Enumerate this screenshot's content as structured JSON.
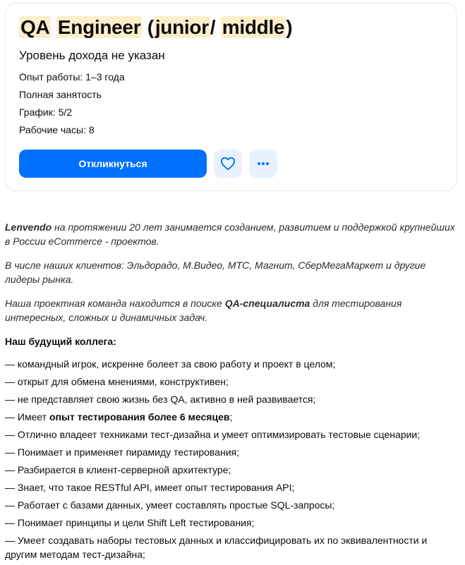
{
  "vacancy": {
    "title_parts": [
      "QA",
      "Engineer",
      "(",
      "junior",
      "/",
      "middle",
      ")"
    ],
    "salary": "Уровень дохода не указан",
    "experience": "Опыт работы: 1–3 года",
    "employment": "Полная занятость",
    "schedule": "График: 5/2",
    "hours": "Рабочие часы: 8",
    "respond_label": "Откликнуться",
    "favorite_icon": "heart-icon",
    "more_icon": "more-dots-icon",
    "accent_color": "#0070ff"
  },
  "description": {
    "p1": {
      "company": "Lenvendo",
      "text": " на протяжении 20 лет занимается созданием, развитием и поддержкой крупнейших в России eCommerce - проектов."
    },
    "p2": "В числе наших клиентов: Эльдорадо, М.Видео, МТС, Магнит, СберМегаМаркет и другие лидеры рынка.",
    "p3": {
      "before": "Наша проектная команда находится в поиске ",
      "bold": "QA-специалиста",
      "after": " для тестирования интересных, сложных и динамичных задач."
    },
    "colleague_heading": "Наш будущий коллега:",
    "items": [
      "— командный игрок, искренне болеет за свою работу и проект в целом;",
      "— открыт для обмена мнениями, конструктивен;",
      "— не представляет свою жизнь без QA, активно в ней развивается;",
      {
        "before": "— Имеет ",
        "bold": "опыт тестирования более 6 месяцев",
        "after": ";"
      },
      "— Отлично владеет техниками тест-дизайна и умеет оптимизировать тестовые сценарии;",
      "— Понимает и применяет пирамиду тестирования;",
      "— Разбирается в клиент-серверной архитектуре;",
      "— Знает, что такое RESTful API, имеет опыт тестирования API;",
      "— Работает с базами данных, умеет составлять простые SQL-запросы;",
      "— Понимает принципы и цели Shift Left тестирования;",
      "— Умеет создавать наборы тестовых данных и классифицировать их по эквивалентности и другим методам тест-дизайна;"
    ]
  }
}
